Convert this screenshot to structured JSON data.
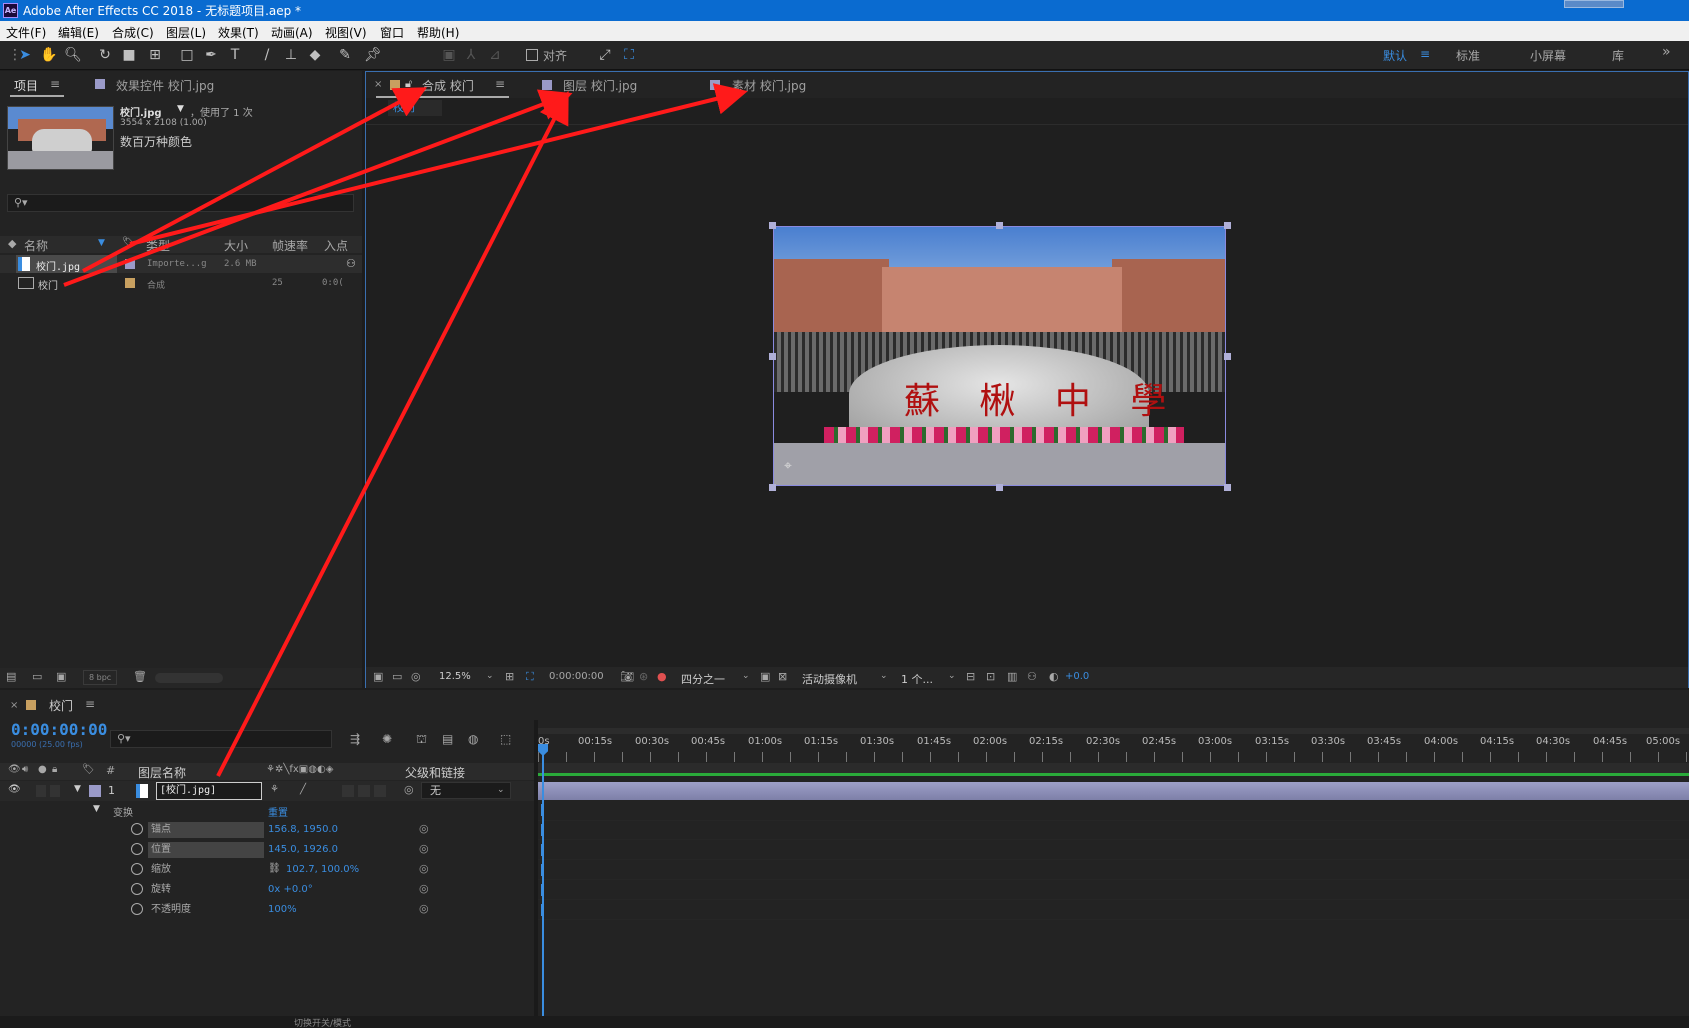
{
  "titlebar": {
    "app_icon": "Ae",
    "title": "Adobe After Effects CC 2018 - 无标题项目.aep *"
  },
  "menu": [
    "文件(F)",
    "编辑(E)",
    "合成(C)",
    "图层(L)",
    "效果(T)",
    "动画(A)",
    "视图(V)",
    "窗口",
    "帮助(H)"
  ],
  "toolbar": {
    "align_label": "对齐",
    "workspaces": [
      "默认",
      "标准",
      "小屏幕",
      "库"
    ],
    "more": "»"
  },
  "project_panel": {
    "tab_project": "项目",
    "tab_effects": "效果控件 校门.jpg",
    "preview": {
      "name": "校门.jpg",
      "used": "，使用了 1 次",
      "dims": "3554 x 2108 (1.00)",
      "colors": "数百万种颜色"
    },
    "columns": [
      "名称",
      "类型",
      "大小",
      "帧速率",
      "入点"
    ],
    "items": [
      {
        "name": "校门.jpg",
        "type": "Importe...g",
        "size": "2.6 MB",
        "fps": "",
        "in": ""
      },
      {
        "name": "校门",
        "type": "合成",
        "size": "",
        "fps": "25",
        "in": "0:0("
      }
    ],
    "bpc": "8 bpc"
  },
  "viewer": {
    "tabs": [
      "合成 校门",
      "图层 校门.jpg",
      "素材 校门.jpg"
    ],
    "breadcrumb": "校门",
    "image_text": "蘇 楸 中 學",
    "bottom": {
      "zoom": "12.5%",
      "timecode": "0:00:00:00",
      "resolution": "四分之一",
      "camera": "活动摄像机",
      "views": "1 个...",
      "exposure": "+0.0"
    }
  },
  "timeline": {
    "tab": "校门",
    "timecode": "0:00:00:00",
    "frames": "00000 (25.00 fps)",
    "col_number": "#",
    "col_layer_name": "图层名称",
    "col_parent": "父级和链接",
    "layer": {
      "index": "1",
      "name": "[校门.jpg]",
      "parent": "无"
    },
    "transform": {
      "label": "变换",
      "reset": "重置"
    },
    "props": [
      {
        "name": "锚点",
        "value": "156.8, 1950.0"
      },
      {
        "name": "位置",
        "value": "145.0, 1926.0"
      },
      {
        "name": "缩放",
        "value": "102.7, 100.0%"
      },
      {
        "name": "旋转",
        "value": "0x +0.0°"
      },
      {
        "name": "不透明度",
        "value": "100%"
      }
    ],
    "ruler": [
      "0s",
      "00:15s",
      "00:30s",
      "00:45s",
      "01:00s",
      "01:15s",
      "01:30s",
      "01:45s",
      "02:00s",
      "02:15s",
      "02:30s",
      "02:45s",
      "03:00s",
      "03:15s",
      "03:30s",
      "03:45s",
      "04:00s",
      "04:15s",
      "04:30s",
      "04:45s",
      "05:00s"
    ],
    "footer": "切换开关/模式"
  },
  "colors": {
    "accent": "#3a8de0",
    "title_blue": "#0a6bd0",
    "annotation": "#ff1a1a"
  }
}
